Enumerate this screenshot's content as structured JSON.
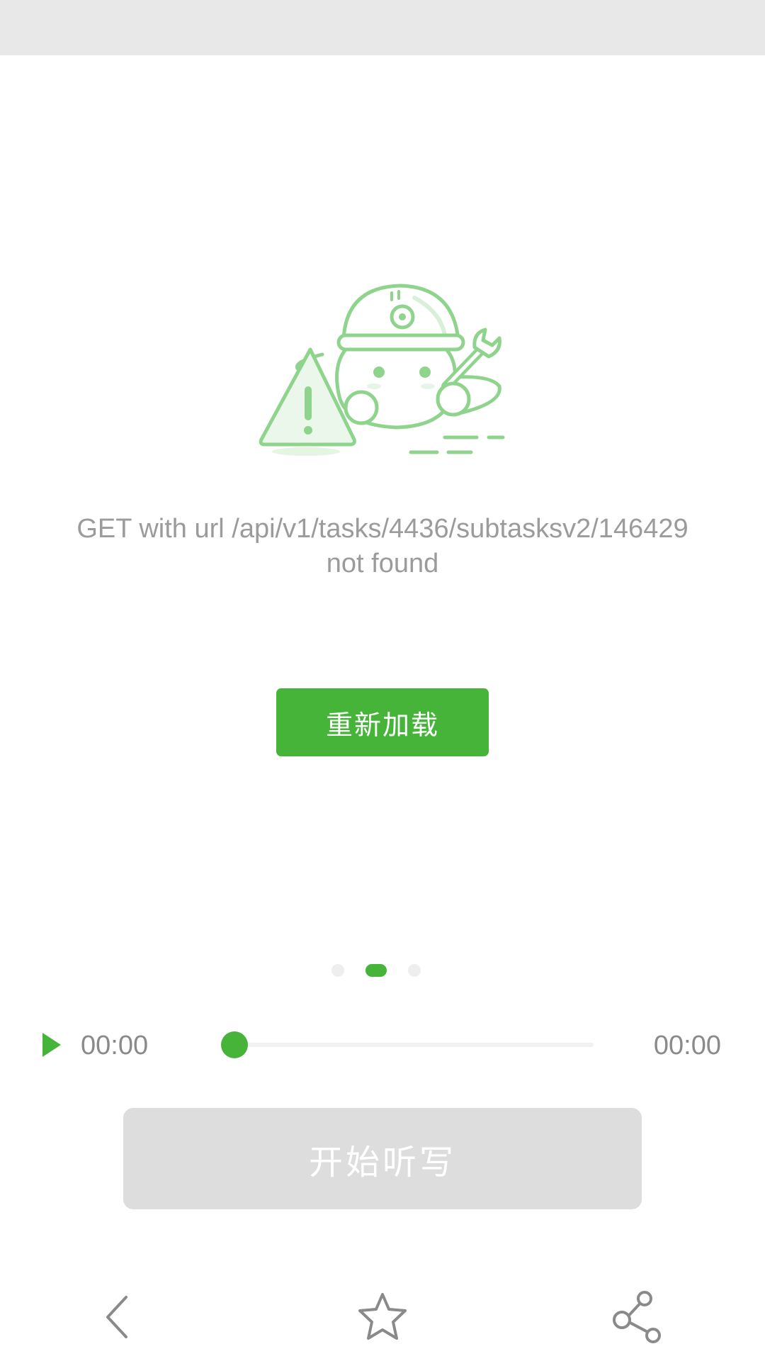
{
  "error": {
    "message": "GET with url /api/v1/tasks/4436/subtasksv2/146429 not found",
    "illustration": "robot-with-wrench-and-warning-icon"
  },
  "reload_button": {
    "label": "重新加载"
  },
  "pager": {
    "dots": 3,
    "active_index": 1
  },
  "player": {
    "play_icon": "play-icon",
    "current_time": "00:00",
    "total_time": "00:00",
    "progress": 0
  },
  "dictation_button": {
    "label": "开始听写",
    "enabled": false
  },
  "bottom_nav": {
    "items": [
      {
        "icon": "back-chevron-icon"
      },
      {
        "icon": "star-icon"
      },
      {
        "icon": "share-icon"
      }
    ]
  },
  "colors": {
    "accent": "#45b439",
    "illustration": "#8fd48d",
    "disabled": "#dddddd",
    "muted_text": "#9b9b9b",
    "status_bar": "#e8e8e8"
  }
}
